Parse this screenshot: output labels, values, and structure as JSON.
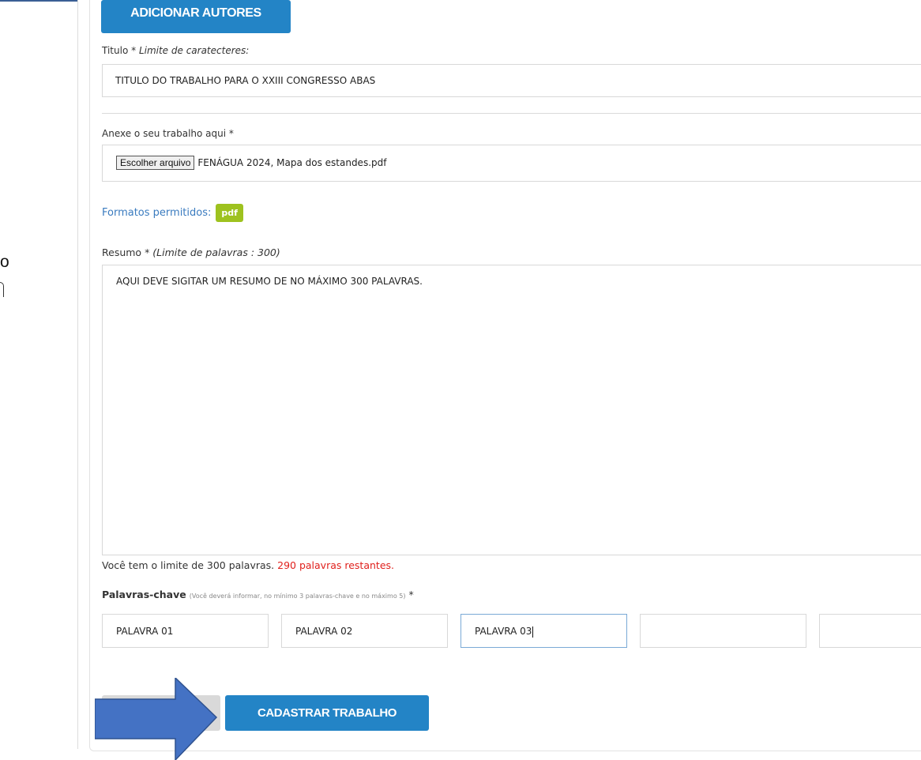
{
  "side_note": {
    "text": "o"
  },
  "buttons": {
    "add_authors": "ADICIONAR AUTORES",
    "submit": "CADASTRAR TRABALHO"
  },
  "title_field": {
    "label": "Titulo",
    "required_mark": "*",
    "hint": "Limite de caratecteres:",
    "value": "TITULO DO TRABALHO PARA O XXIII CONGRESSO ABAS"
  },
  "attachment": {
    "label": "Anexe o seu trabalho aqui *",
    "choose_button": "Escolher arquivo",
    "file_name": "FENÁGUA 2024, Mapa dos estandes.pdf"
  },
  "formats": {
    "label": "Formatos permitidos:",
    "badge": "pdf"
  },
  "summary": {
    "label": "Resumo",
    "required_mark": "*",
    "hint": "(Limite de palavras : 300)",
    "value": "AQUI DEVE SIGITAR UM RESUMO DE NO MÁXIMO 300 PALAVRAS.",
    "limit_text": "Você tem o limite de 300 palavras.",
    "remaining_text": "290 palavras restantes."
  },
  "keywords": {
    "label": "Palavras-chave",
    "hint": "(Você deverá informar, no mínimo 3 palavras-chave e no máximo 5)",
    "required_mark": "*",
    "values": [
      "PALAVRA 01",
      "PALAVRA 02",
      "PALAVRA 03",
      "",
      ""
    ]
  },
  "colors": {
    "primary": "#2384c6",
    "badge": "#9ec21f",
    "remaining": "#e0201c",
    "arrow": "#4472c4"
  }
}
